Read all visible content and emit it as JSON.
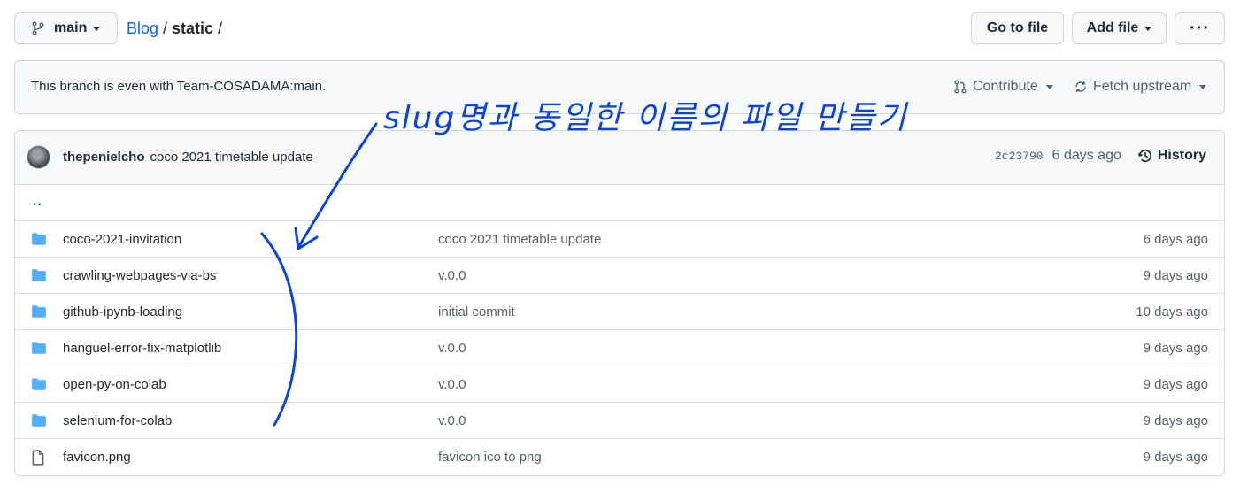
{
  "topbar": {
    "branch_label": "main",
    "breadcrumb_repo": "Blog",
    "breadcrumb_sep": "/",
    "breadcrumb_current": "static",
    "breadcrumb_trailing_sep": "/",
    "goto_file_label": "Go to file",
    "add_file_label": "Add file",
    "more_label": "···"
  },
  "branch_status": {
    "text": "This branch is even with Team-COSADAMA:main.",
    "contribute_label": "Contribute",
    "fetch_label": "Fetch upstream"
  },
  "latest_commit": {
    "author": "thepenielcho",
    "message": "coco 2021 timetable update",
    "sha": "2c23790",
    "age": "6 days ago",
    "history_label": "History"
  },
  "parent_dir_label": "..",
  "files": [
    {
      "type": "folder",
      "name": "coco-2021-invitation",
      "commit": "coco 2021 timetable update",
      "age": "6 days ago"
    },
    {
      "type": "folder",
      "name": "crawling-webpages-via-bs",
      "commit": "v.0.0",
      "age": "9 days ago"
    },
    {
      "type": "folder",
      "name": "github-ipynb-loading",
      "commit": "initial commit",
      "age": "10 days ago"
    },
    {
      "type": "folder",
      "name": "hanguel-error-fix-matplotlib",
      "commit": "v.0.0",
      "age": "9 days ago"
    },
    {
      "type": "folder",
      "name": "open-py-on-colab",
      "commit": "v.0.0",
      "age": "9 days ago"
    },
    {
      "type": "folder",
      "name": "selenium-for-colab",
      "commit": "v.0.0",
      "age": "9 days ago"
    },
    {
      "type": "file",
      "name": "favicon.png",
      "commit": "favicon ico to png",
      "age": "9 days ago"
    }
  ],
  "annotation": {
    "text": "slug명과 동일한 이름의 파일 만들기",
    "color": "#0b45d8"
  },
  "colors": {
    "link": "#0969da",
    "folder_icon": "#54aeff",
    "muted": "#57606a",
    "border": "#d0d7de"
  }
}
